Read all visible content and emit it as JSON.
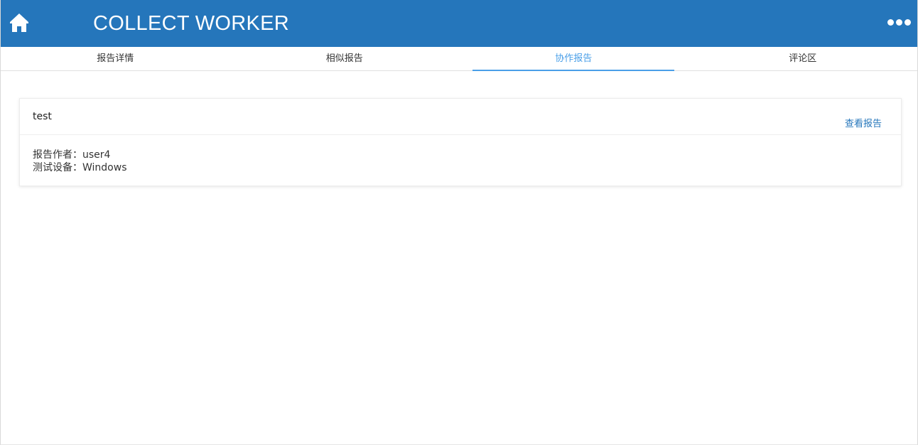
{
  "header": {
    "title": "COLLECT WORKER",
    "home_icon": "home-icon",
    "more_icon": "more-horizontal-icon",
    "background_color": "#2576bb"
  },
  "tabs": [
    {
      "label": "报告详情",
      "active": false
    },
    {
      "label": "相似报告",
      "active": false
    },
    {
      "label": "协作报告",
      "active": true
    },
    {
      "label": "评论区",
      "active": false
    }
  ],
  "tab_active_color": "#4a9fe8",
  "report_card": {
    "title": "test",
    "view_link": "查看报告",
    "author_label": "报告作者：",
    "author_value": "user4",
    "device_label": "测试设备：",
    "device_value": "Windows"
  }
}
